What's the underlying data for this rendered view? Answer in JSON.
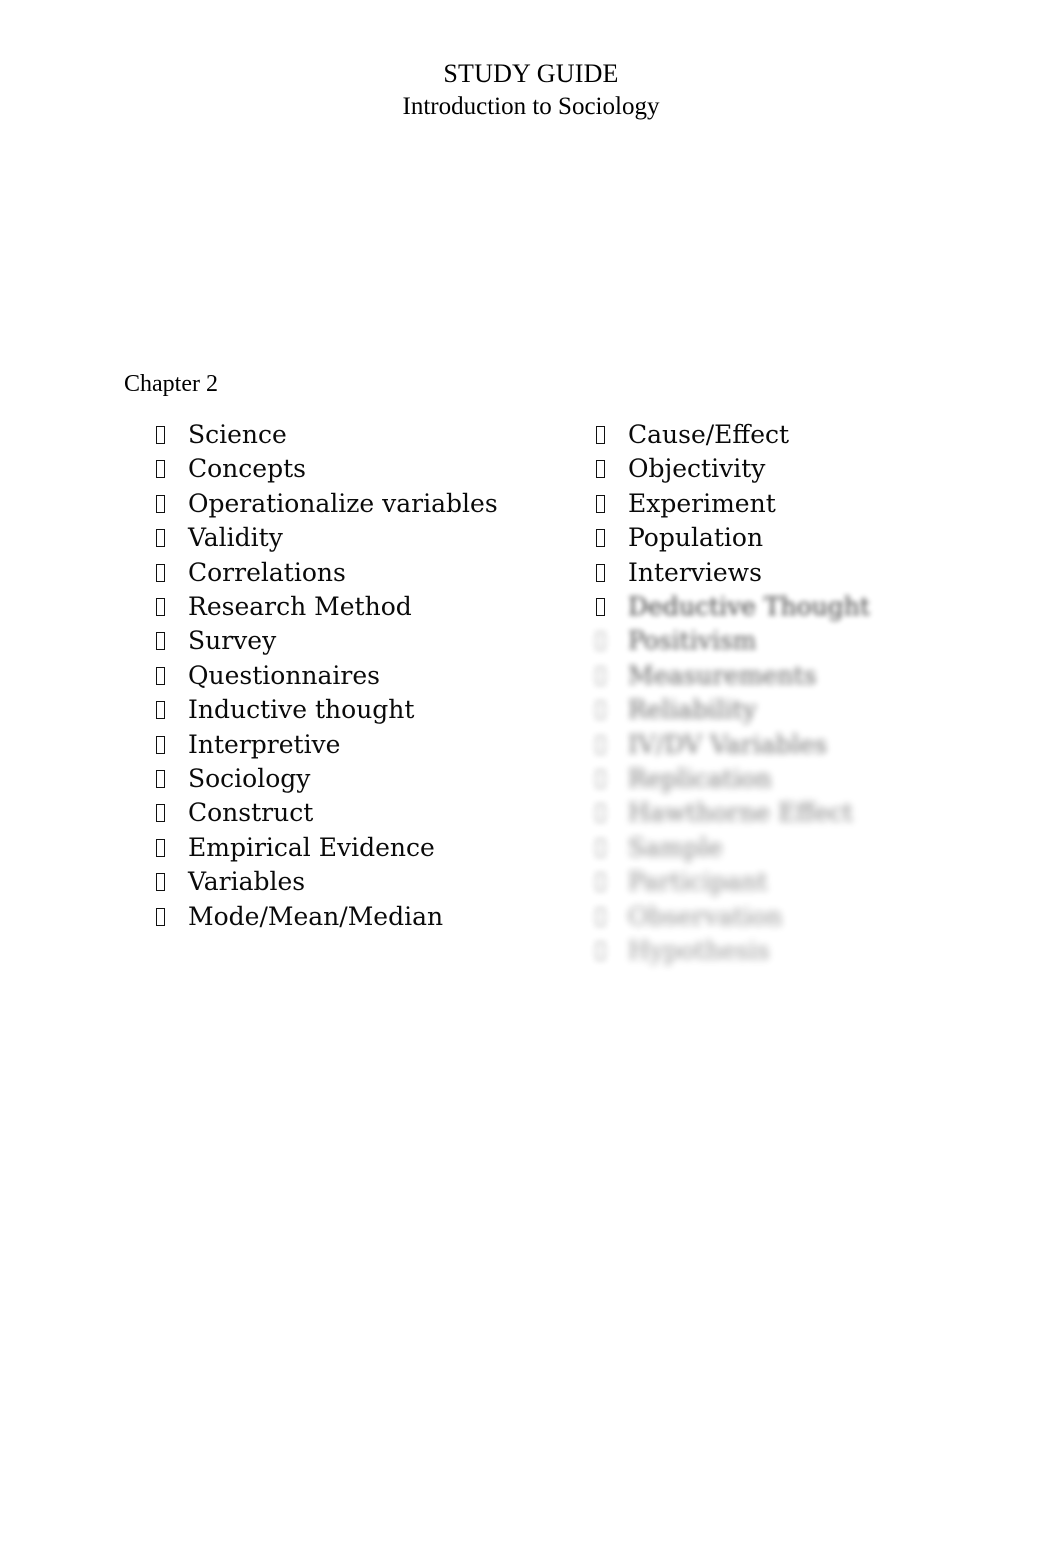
{
  "document": {
    "title": "STUDY GUIDE",
    "subtitle": "Introduction to Sociology",
    "chapter_label": "Chapter 2"
  },
  "bullet": {
    "glyph_name": "missing-glyph-box-bullet"
  },
  "terms": {
    "left_column": [
      {
        "label": "Science",
        "redacted": false
      },
      {
        "label": "Concepts",
        "redacted": false
      },
      {
        "label": "Operationalize variables",
        "redacted": false
      },
      {
        "label": "Validity",
        "redacted": false
      },
      {
        "label": "Correlations",
        "redacted": false
      },
      {
        "label": "Research Method",
        "redacted": false
      },
      {
        "label": "Survey",
        "redacted": false
      },
      {
        "label": "Questionnaires",
        "redacted": false
      },
      {
        "label": "Inductive thought",
        "redacted": false
      },
      {
        "label": "Interpretive",
        "redacted": false
      },
      {
        "label": "Sociology",
        "redacted": false
      },
      {
        "label": "Construct",
        "redacted": false
      },
      {
        "label": "Empirical Evidence",
        "redacted": false
      },
      {
        "label": "Variables",
        "redacted": false
      },
      {
        "label": "Mode/Mean/Median",
        "redacted": false
      }
    ],
    "right_column": [
      {
        "label": "Cause/Effect",
        "redacted": false
      },
      {
        "label": "Objectivity",
        "redacted": false
      },
      {
        "label": "Experiment",
        "redacted": false
      },
      {
        "label": "Population",
        "redacted": false
      },
      {
        "label": "Interviews",
        "redacted": false
      },
      {
        "label": "Deductive Thought",
        "redacted": true
      },
      {
        "label": "Positivism",
        "redacted": true
      },
      {
        "label": "Measurements",
        "redacted": true
      },
      {
        "label": "Reliability",
        "redacted": true
      },
      {
        "label": "IV/DV Variables",
        "redacted": true
      },
      {
        "label": "Replication",
        "redacted": true
      },
      {
        "label": "Hawthorne Effect",
        "redacted": true
      },
      {
        "label": "Sample",
        "redacted": true
      },
      {
        "label": "Participant",
        "redacted": true
      },
      {
        "label": "Observation",
        "redacted": true
      },
      {
        "label": "Hypothesis",
        "redacted": true
      }
    ]
  },
  "colors": {
    "page_background": "#ffffff",
    "text": "#000000"
  }
}
